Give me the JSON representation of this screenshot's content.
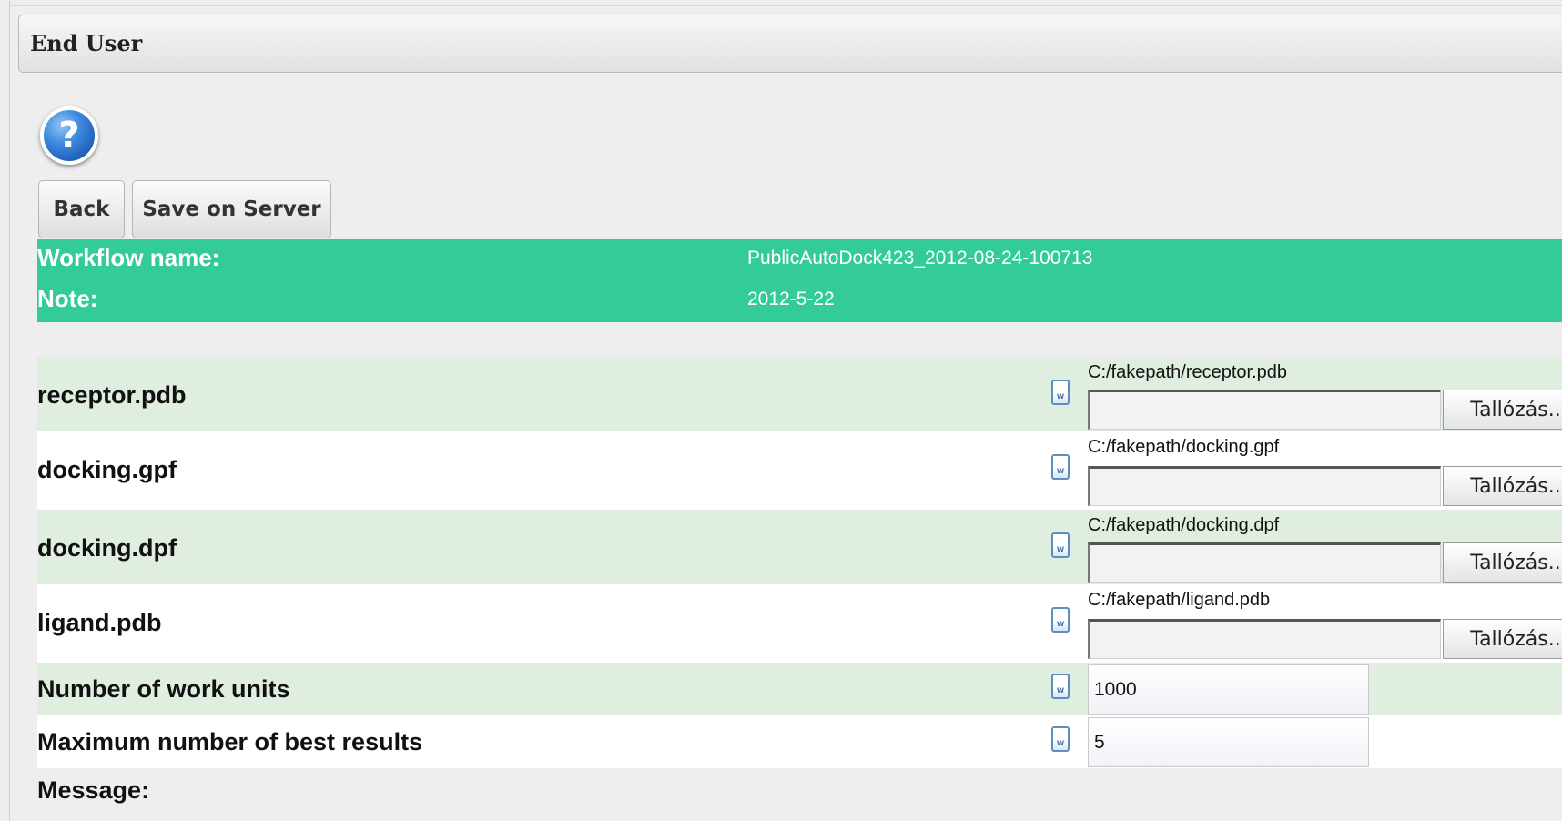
{
  "panel": {
    "title": "End User"
  },
  "toolbar": {
    "back_label": "Back",
    "save_label": "Save on Server"
  },
  "help_icon": {
    "glyph": "?",
    "icon": "help-icon"
  },
  "info": {
    "workflow_label": "Workflow name:",
    "workflow_value": "PublicAutoDock423_2012-08-24-100713",
    "note_label": "Note:",
    "note_value": "2012-5-22"
  },
  "files": [
    {
      "label": "receptor.pdb",
      "path": "C:/fakepath/receptor.pdb",
      "browse_label": "Tallózás..."
    },
    {
      "label": "docking.gpf",
      "path": "C:/fakepath/docking.gpf",
      "browse_label": "Tallózás..."
    },
    {
      "label": "docking.dpf",
      "path": "C:/fakepath/docking.dpf",
      "browse_label": "Tallózás..."
    },
    {
      "label": "ligand.pdb",
      "path": "C:/fakepath/ligand.pdb",
      "browse_label": "Tallózás..."
    }
  ],
  "params": [
    {
      "label": "Number of work units",
      "value": "1000"
    },
    {
      "label": "Maximum number of best results",
      "value": "5"
    }
  ],
  "doc_icon_glyph": "w",
  "message": {
    "label": "Message:"
  },
  "colors": {
    "info_bar": "#33cc99",
    "row_shade": "#e0eee0",
    "row_plain": "#ffffff"
  }
}
